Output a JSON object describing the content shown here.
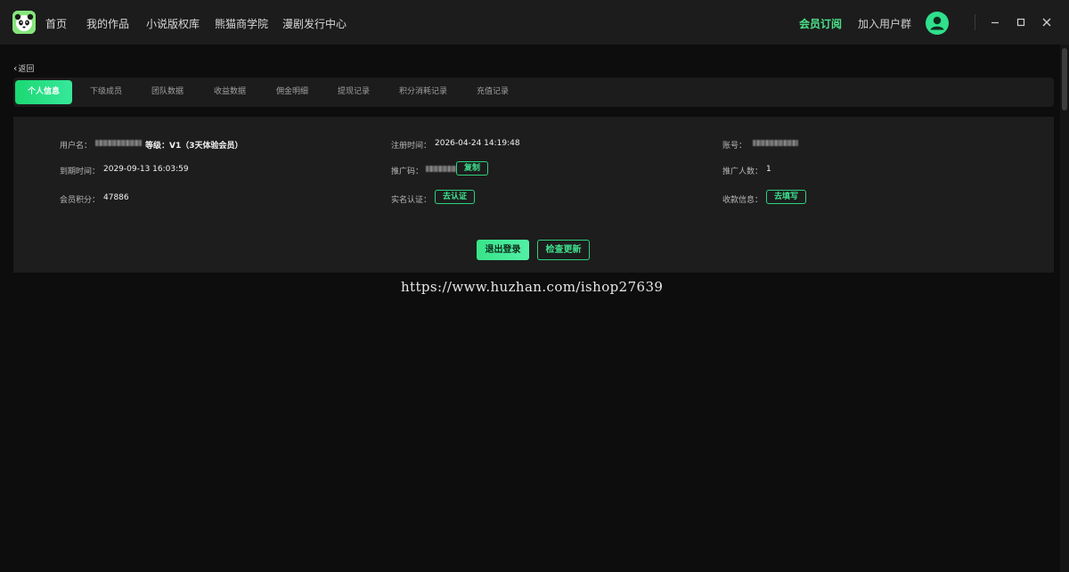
{
  "nav": {
    "items": [
      {
        "label": "首页"
      },
      {
        "label": "我的作品"
      },
      {
        "label": "小说版权库"
      },
      {
        "label": "熊猫商学院"
      },
      {
        "label": "漫剧发行中心"
      }
    ],
    "vip_label": "会员订阅",
    "group_label": "加入用户群"
  },
  "back_label": "返回",
  "tabs": [
    {
      "label": "个人信息",
      "active": true
    },
    {
      "label": "下级成员"
    },
    {
      "label": "团队数据"
    },
    {
      "label": "收益数据"
    },
    {
      "label": "佣金明细"
    },
    {
      "label": "提现记录"
    },
    {
      "label": "积分消耗记录"
    },
    {
      "label": "充值记录"
    }
  ],
  "profile": {
    "username_label": "用户名：",
    "level_text": "等级：V1（3天体验会员）",
    "register_label": "注册时间：",
    "register_value": "2026-04-24 14:19:48",
    "account_label": "账号：",
    "expire_label": "到期时间：",
    "expire_value": "2029-09-13 16:03:59",
    "promo_code_label": "推广码：",
    "copy_label": "复制",
    "promo_count_label": "推广人数：",
    "promo_count_value": "1",
    "points_label": "会员积分：",
    "points_value": "47886",
    "realname_label": "实名认证：",
    "realname_button": "去认证",
    "payment_label": "收款信息：",
    "payment_button": "去填写"
  },
  "actions": {
    "logout_label": "退出登录",
    "update_label": "检查更新"
  },
  "watermark": "https://www.huzhan.com/ishop27639",
  "colors": {
    "accent": "#2fe08c",
    "background": "#0d0d0d",
    "panel": "#1d1d1d"
  },
  "icons": {
    "logo": "panda-logo-icon",
    "avatar": "user-avatar-icon",
    "minimize": "minimize-icon",
    "maximize": "maximize-icon",
    "close": "close-icon",
    "back": "chevron-left-icon"
  }
}
